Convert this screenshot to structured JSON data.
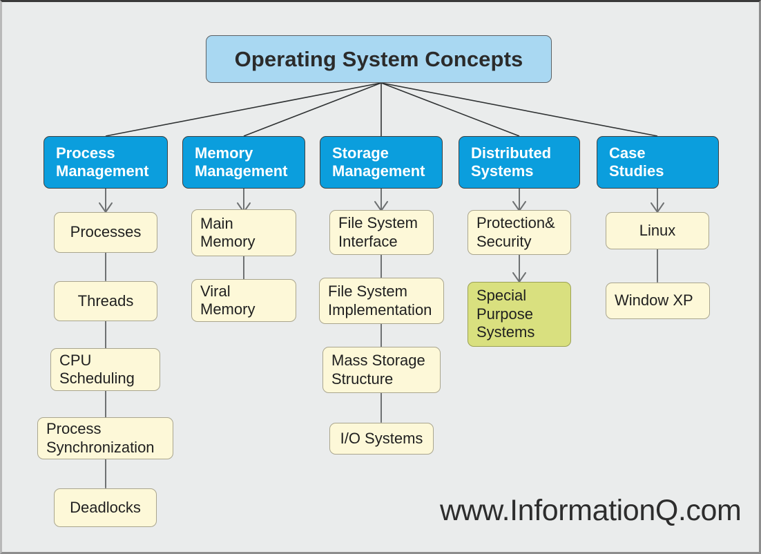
{
  "diagram": {
    "title": "Operating System Concepts",
    "watermark": "www.InformationQ.com",
    "colors": {
      "background": "#eaecec",
      "root_fill": "#a9d8f2",
      "category_fill": "#0b9edd",
      "category_text": "#ffffff",
      "leaf_fill": "#fdf8d8",
      "leaf_border": "#a9a58d",
      "highlight_fill": "#d9e07f",
      "edge": "#6e7172",
      "root_edge": "#2f3233"
    },
    "root": {
      "label": "Operating System Concepts"
    },
    "branches": [
      {
        "label": "Process\nManagement",
        "children": [
          {
            "label": "Processes"
          },
          {
            "label": "Threads"
          },
          {
            "label": "CPU\nScheduling"
          },
          {
            "label": "Process\nSynchronization"
          },
          {
            "label": "Deadlocks"
          }
        ]
      },
      {
        "label": "Memory\nManagement",
        "children": [
          {
            "label": "Main\nMemory"
          },
          {
            "label": "Viral\nMemory"
          }
        ]
      },
      {
        "label": "Storage\nManagement",
        "children": [
          {
            "label": "File System\nInterface"
          },
          {
            "label": "File System\nImplementation"
          },
          {
            "label": "Mass Storage\nStructure"
          },
          {
            "label": "I/O Systems"
          }
        ]
      },
      {
        "label": "Distributed\nSystems",
        "children": [
          {
            "label": "Protection&\nSecurity"
          },
          {
            "label": "Special\nPurpose\nSystems"
          }
        ]
      },
      {
        "label": "Case\nStudies",
        "children": [
          {
            "label": "Linux"
          },
          {
            "label": "Window XP"
          }
        ]
      }
    ]
  }
}
